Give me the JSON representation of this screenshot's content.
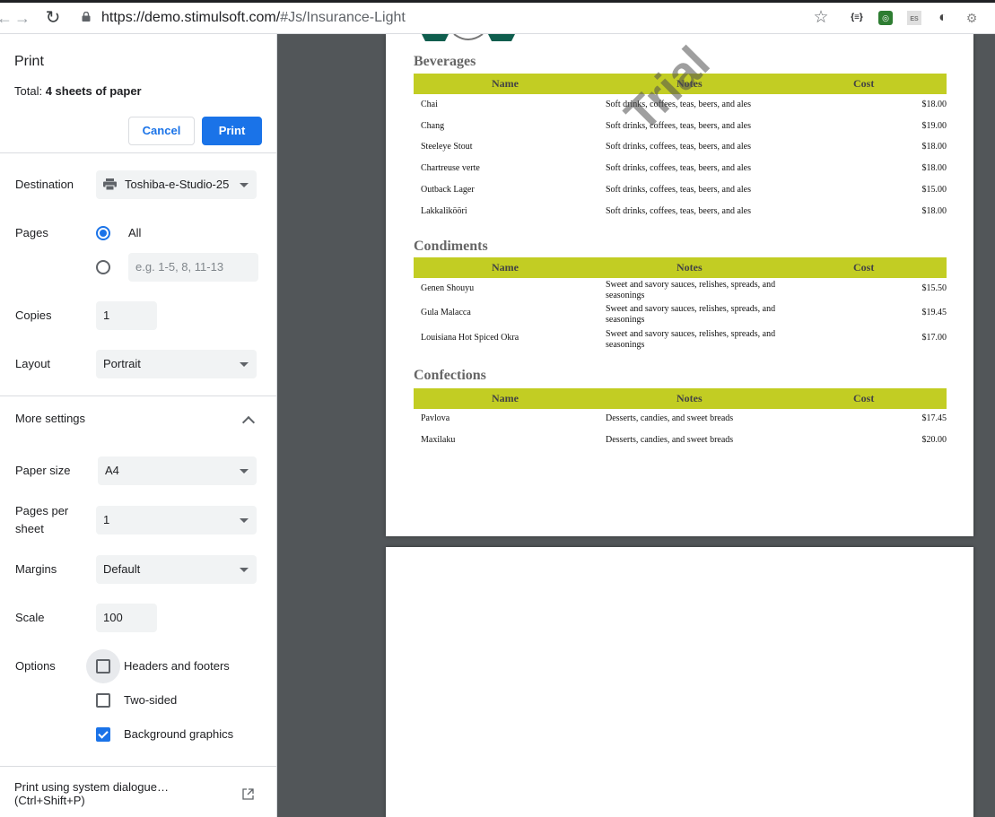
{
  "browser": {
    "url_host": "https://demo.stimulsoft.com/",
    "url_path": "#Js/Insurance-Light",
    "ext1_text": "{≡}",
    "ext3_text": "ES"
  },
  "print_panel": {
    "title": "Print",
    "total_prefix": "Total: ",
    "total_value": "4 sheets of paper",
    "cancel_label": "Cancel",
    "print_label": "Print",
    "destination_label": "Destination",
    "destination_value": "Toshiba-e-Studio-25",
    "pages_label": "Pages",
    "pages_all_label": "All",
    "pages_custom_placeholder": "e.g. 1-5, 8, 11-13",
    "copies_label": "Copies",
    "copies_value": "1",
    "layout_label": "Layout",
    "layout_value": "Portrait",
    "more_settings_label": "More settings",
    "paper_size_label": "Paper size",
    "paper_size_value": "A4",
    "pages_per_sheet_label_1": "Pages per",
    "pages_per_sheet_label_2": "sheet",
    "pages_per_sheet_value": "1",
    "margins_label": "Margins",
    "margins_value": "Default",
    "scale_label": "Scale",
    "scale_value": "100",
    "options_label": "Options",
    "opt_headers_label": "Headers and footers",
    "opt_twosided_label": "Two-sided",
    "opt_bg_label": "Background graphics",
    "opt_headers_checked": false,
    "opt_twosided_checked": false,
    "opt_bg_checked": true,
    "system_dialog_line1": "Print using system dialogue…",
    "system_dialog_line2": "(Ctrl+Shift+P)"
  },
  "report": {
    "watermark": "Trial",
    "header_color": "#c2cd23",
    "columns": {
      "name": "Name",
      "notes": "Notes",
      "cost": "Cost"
    },
    "beverages": {
      "title": "Beverages",
      "rows": [
        {
          "name": "Chai",
          "notes": "Soft drinks, coffees, teas, beers, and ales",
          "cost": "$18.00"
        },
        {
          "name": "Chang",
          "notes": "Soft drinks, coffees, teas, beers, and ales",
          "cost": "$19.00"
        },
        {
          "name": "Steeleye Stout",
          "notes": "Soft drinks, coffees, teas, beers, and ales",
          "cost": "$18.00"
        },
        {
          "name": "Chartreuse verte",
          "notes": "Soft drinks, coffees, teas, beers, and ales",
          "cost": "$18.00"
        },
        {
          "name": "Outback Lager",
          "notes": "Soft drinks, coffees, teas, beers, and ales",
          "cost": "$15.00"
        },
        {
          "name": "Lakkalikööri",
          "notes": "Soft drinks, coffees, teas, beers, and ales",
          "cost": "$18.00"
        }
      ]
    },
    "condiments": {
      "title": "Condiments",
      "rows": [
        {
          "name": "Genen Shouyu",
          "notes": "Sweet and savory sauces, relishes, spreads, and seasonings",
          "cost": "$15.50"
        },
        {
          "name": "Gula Malacca",
          "notes": "Sweet and savory sauces, relishes, spreads, and seasonings",
          "cost": "$19.45"
        },
        {
          "name": "Louisiana Hot Spiced Okra",
          "notes": "Sweet and savory sauces, relishes, spreads, and seasonings",
          "cost": "$17.00"
        }
      ]
    },
    "confections": {
      "title": "Confections",
      "rows": [
        {
          "name": "Pavlova",
          "notes": "Desserts, candies, and sweet breads",
          "cost": "$17.45"
        },
        {
          "name": "Maxilaku",
          "notes": "Desserts, candies, and sweet breads",
          "cost": "$20.00"
        }
      ]
    }
  }
}
